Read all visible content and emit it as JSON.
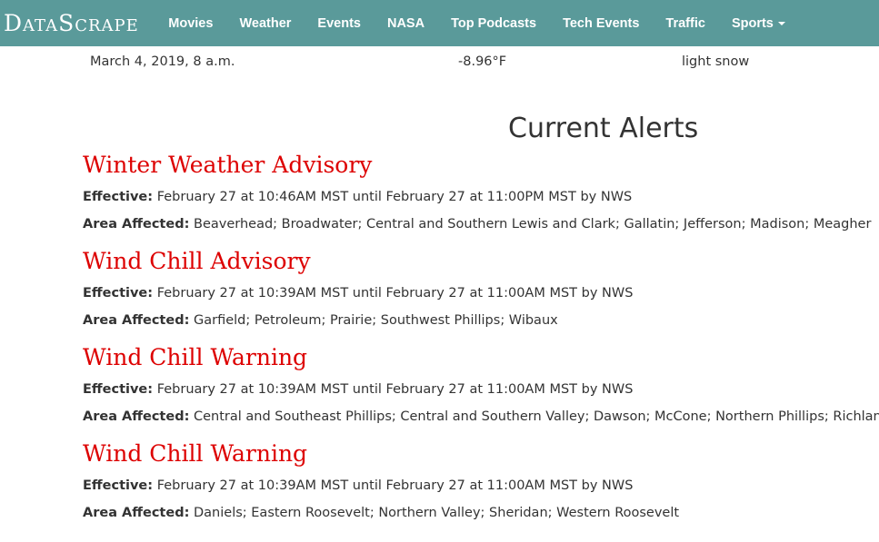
{
  "nav": {
    "brand": "DataScrape",
    "items": [
      "Movies",
      "Weather",
      "Events",
      "NASA",
      "Top Podcasts",
      "Tech Events",
      "Traffic",
      "Sports"
    ]
  },
  "weather": {
    "date": "March 4, 2019, 8 a.m.",
    "temp": "-8.96°F",
    "condition": "light snow"
  },
  "alerts_title": "Current Alerts",
  "labels": {
    "effective": "Effective:",
    "area": "Area Affected:"
  },
  "alerts": [
    {
      "title": "Winter Weather Advisory",
      "effective": "February 27 at 10:46AM MST until February 27 at 11:00PM MST by NWS",
      "area": "Beaverhead; Broadwater; Central and Southern Lewis and Clark; Gallatin; Jefferson; Madison; Meagher"
    },
    {
      "title": "Wind Chill Advisory",
      "effective": "February 27 at 10:39AM MST until February 27 at 11:00AM MST by NWS",
      "area": "Garfield; Petroleum; Prairie; Southwest Phillips; Wibaux"
    },
    {
      "title": "Wind Chill Warning",
      "effective": "February 27 at 10:39AM MST until February 27 at 11:00AM MST by NWS",
      "area": "Central and Southeast Phillips; Central and Southern Valley; Dawson; McCone; Northern Phillips; Richland"
    },
    {
      "title": "Wind Chill Warning",
      "effective": "February 27 at 10:39AM MST until February 27 at 11:00AM MST by NWS",
      "area": "Daniels; Eastern Roosevelt; Northern Valley; Sheridan; Western Roosevelt"
    }
  ],
  "colors": {
    "navbar": "#5a9a9a",
    "alert_title": "#dd0000"
  }
}
